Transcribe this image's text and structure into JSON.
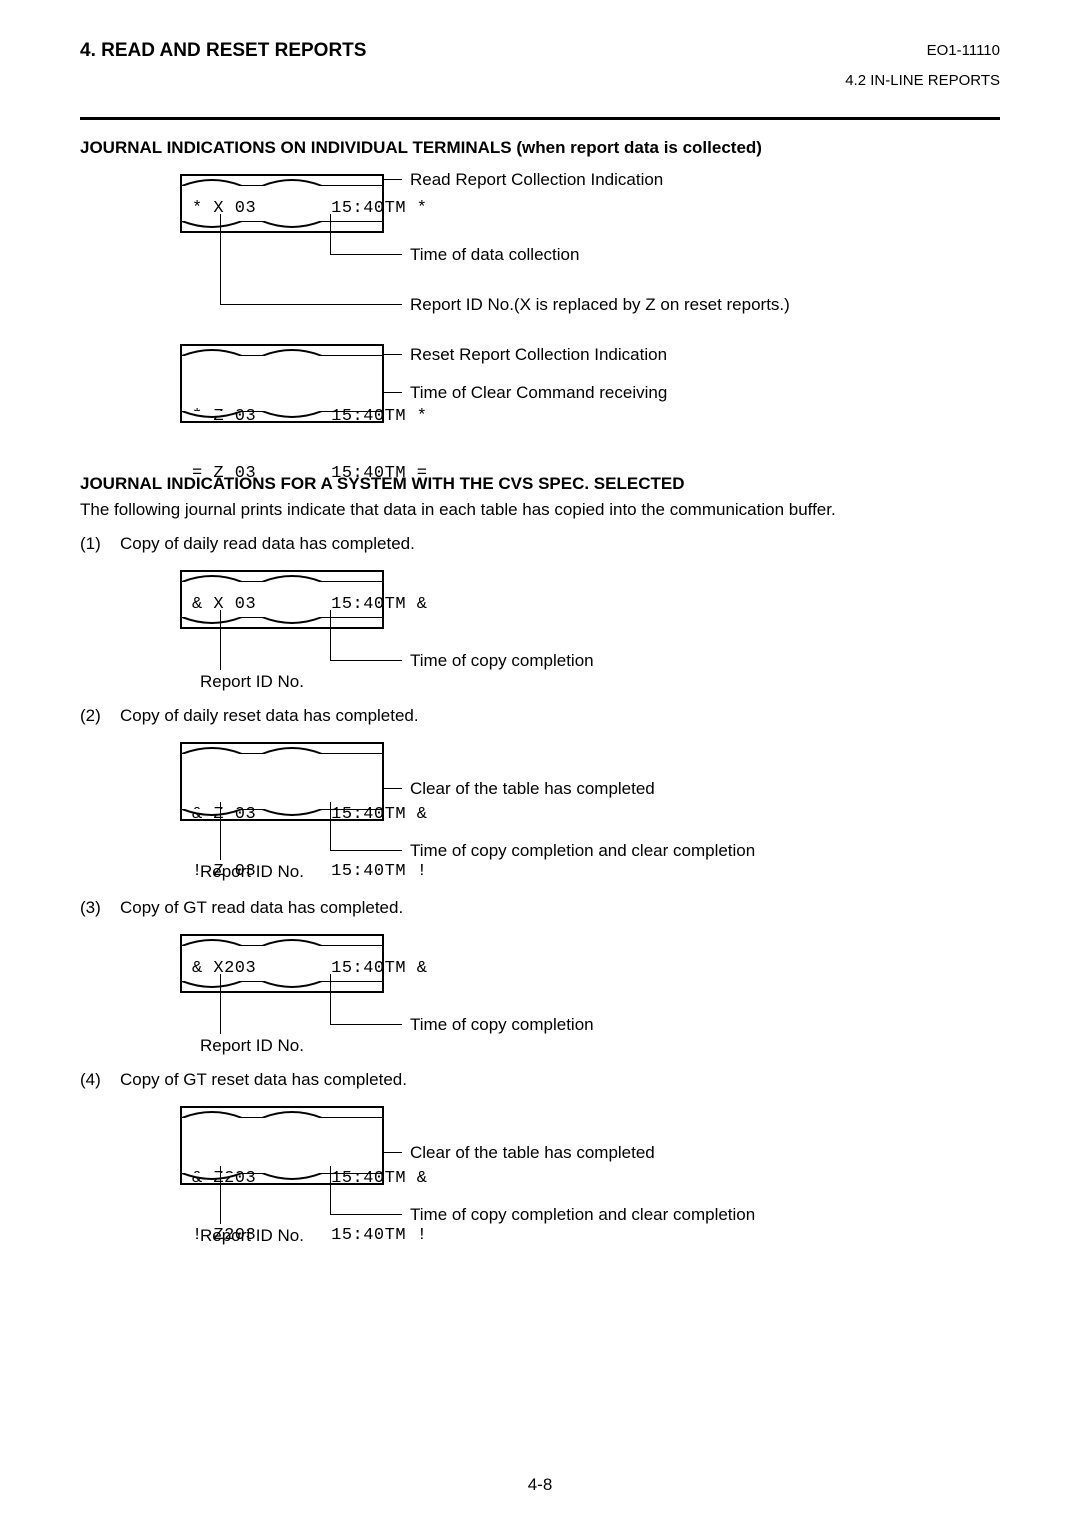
{
  "header": {
    "left": "4.   READ AND RESET REPORTS",
    "right": "EO1-11110",
    "sub": "4.2  IN-LINE REPORTS"
  },
  "sec1": {
    "title": "JOURNAL INDICATIONS ON INDIVIDUAL TERMINALS (when report data is collected)",
    "receipt1_line": "* X 03       15:40TM *",
    "receipt2_line1": "* Z 03       15:40TM *",
    "receipt2_line2": "= Z 03       15:40TM =",
    "lbl_read": "Read Report Collection Indication",
    "lbl_time": "Time of data collection",
    "lbl_id": "Report ID No.(X is replaced by Z on reset reports.)",
    "lbl_reset": "Reset Report Collection Indication",
    "lbl_clear": "Time of Clear Command receiving"
  },
  "sec2": {
    "title": "JOURNAL INDICATIONS FOR A SYSTEM WITH THE CVS SPEC. SELECTED",
    "intro": "The following journal prints indicate that data in each table has copied into the communication buffer.",
    "items": [
      {
        "num": "(1)",
        "text": "Copy of daily read data has completed.",
        "lines": [
          "& X 03       15:40TM &"
        ],
        "lblA": "Time of copy completion",
        "lblB": "Report ID No."
      },
      {
        "num": "(2)",
        "text": "Copy of daily reset data has completed.",
        "lines": [
          "& Z 03       15:40TM &",
          "! Z 03       15:40TM !"
        ],
        "lblR": "Clear of the table has completed",
        "lblA": "Time of copy completion and clear completion",
        "lblB": "Report ID No."
      },
      {
        "num": "(3)",
        "text": "Copy of GT read data has completed.",
        "lines": [
          "& X203       15:40TM &"
        ],
        "lblA": "Time of copy completion",
        "lblB": "Report ID No."
      },
      {
        "num": "(4)",
        "text": "Copy of GT reset data has completed.",
        "lines": [
          "& Z203       15:40TM &",
          "! Z203       15:40TM !"
        ],
        "lblR": "Clear of the table has completed",
        "lblA": "Time of copy completion and clear completion",
        "lblB": "Report ID No."
      }
    ]
  },
  "page_number": "4-8"
}
